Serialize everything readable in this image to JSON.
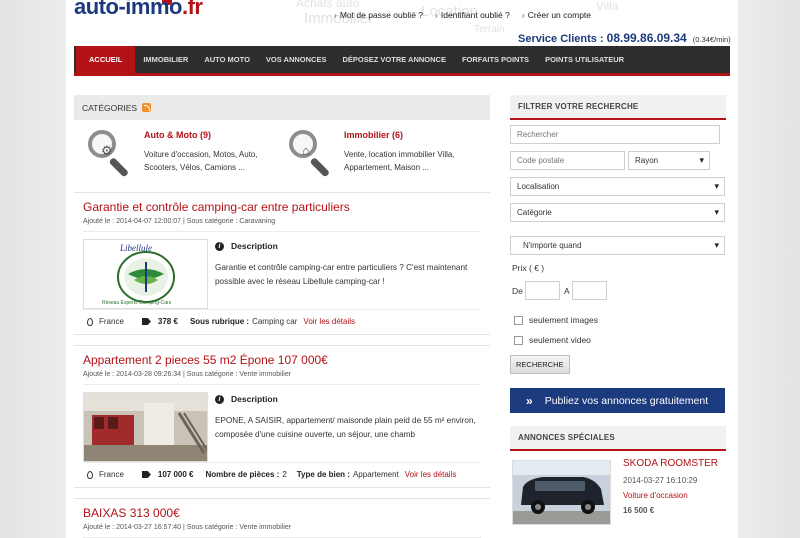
{
  "header": {
    "logo_main": "auto-immo",
    "logo_tld": ".fr",
    "ghost_words": [
      "Achats auto",
      "Location",
      "Villa",
      "Immobilier",
      "Terrain"
    ],
    "top_links": [
      "Mot de passe oublié ?",
      "Identifiant oublié ?",
      "Créer un compte"
    ],
    "service_label": "Service Clients :",
    "service_number": "08.99.86.09.34",
    "service_price": "(0.34€/min)"
  },
  "nav": {
    "items": [
      "ACCUEIL",
      "IMMOBILIER",
      "AUTO MOTO",
      "VOS ANNONCES",
      "DÉPOSEZ VOTRE ANNONCE",
      "FORFAITS POINTS",
      "POINTS UTILISATEUR"
    ]
  },
  "categories": {
    "heading": "CATÉGORIES",
    "items": [
      {
        "title": "Auto & Moto (9)",
        "desc": "Voiture d'occasion, Motos, Auto, Scooters, Vélos, Camions ..."
      },
      {
        "title": "Immobilier (6)",
        "desc": "Vente, location immobilier Villa, Appartement, Maison ..."
      }
    ]
  },
  "listings": [
    {
      "title": "Garantie et contrôle camping-car entre particuliers",
      "meta": "Ajouté le : 2014-04-07 12:00:07 | Sous catégorie : Caravaning",
      "desc_heading": "Description",
      "desc": "Garantie et contrôle camping-car entre particuliers ? C'est maintenant possible avec le réseau Libellule camping-car !",
      "thumb_text": "Libellule",
      "thumb_subtext": "Réseau Experts Camping-Cars",
      "country": "France",
      "price": "378 €",
      "f1_label": "Sous rubrique :",
      "f1_value": "Camping car",
      "details": "Voir les détails"
    },
    {
      "title": "Appartement 2 pieces 55 m2 Épone 107 000€",
      "meta": "Ajouté le : 2014-03-28 09:26:34 | Sous catégorie : Vente immobilier",
      "desc_heading": "Description",
      "desc": "EPONE, A SAISIR, appartement/ maisonde plain peid de 55 m² environ, composée d'une cuisine ouverte, un séjour, une chamb",
      "country": "France",
      "price": "107 000 €",
      "f1_label": "Nombre de pièces :",
      "f1_value": "2",
      "f2_label": "Type de bien :",
      "f2_value": "Appartement",
      "details": "Voir les détails"
    },
    {
      "title": "BAIXAS 313 000€",
      "meta": "Ajouté le : 2014-03-27 16:57:40 | Sous catégorie : Vente immobilier"
    }
  ],
  "filter": {
    "heading": "FILTRER VOTRE RECHERCHE",
    "search_placeholder": "Rechercher",
    "postcode_placeholder": "Code postale",
    "radius": "Rayon",
    "location": "Localisation",
    "category": "Catégorie",
    "when": "N'importe quand",
    "price_label": "Prix ( € )",
    "from_label": "De",
    "to_label": "A",
    "images_only": "seulement images",
    "video_only": "seulement video",
    "search_button": "RECHERCHE"
  },
  "publish_banner": "Publiez vos annonces gratuitement",
  "special": {
    "heading": "ANNONCES SPÉCIALES",
    "title": "SKODA ROOMSTER",
    "date": "2014-03-27 16:10:29",
    "category": "Voiture d'occasion",
    "price": "16 500 €"
  },
  "colors": {
    "accent_red": "#b31216",
    "brand_blue": "#1c3b7e",
    "nav_dark": "#2e2e2e"
  }
}
